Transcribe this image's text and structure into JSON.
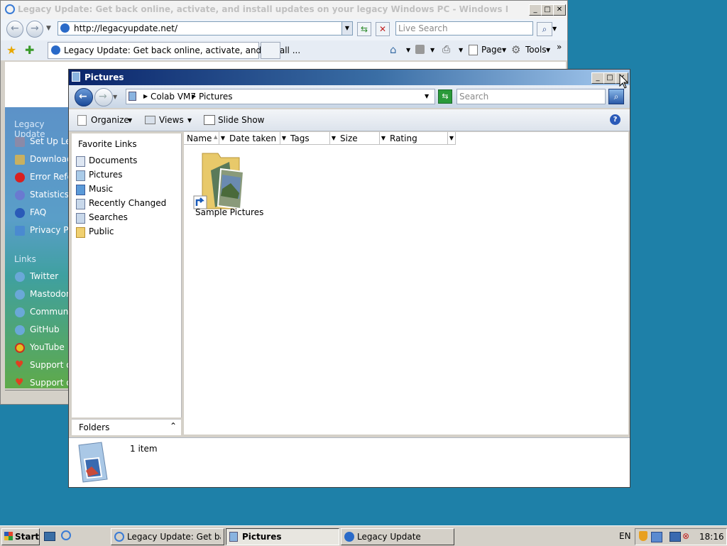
{
  "ie": {
    "title": "Legacy Update: Get back online, activate, and install updates on your legacy Windows PC - Windows Internet Explorer",
    "address": "http://legacyupdate.net/",
    "search_placeholder": "Live Search",
    "tab_label": "Legacy Update: Get back online, activate, and install ...",
    "cmd_page": "Page",
    "cmd_tools": "Tools",
    "sidebar": {
      "heading": "Legacy Update",
      "items": [
        {
          "label": "Set Up Le",
          "icon": "setup-icon"
        },
        {
          "label": "Download",
          "icon": "download-icon"
        },
        {
          "label": "Error Refe",
          "icon": "error-icon"
        },
        {
          "label": "Statistics",
          "icon": "statistics-icon"
        },
        {
          "label": "FAQ",
          "icon": "help-icon"
        },
        {
          "label": "Privacy Po",
          "icon": "privacy-icon"
        }
      ],
      "links_heading": "Links",
      "links": [
        {
          "label": "Twitter",
          "icon": "twitter-icon"
        },
        {
          "label": "Mastodon",
          "icon": "mastodon-icon"
        },
        {
          "label": "Communit",
          "icon": "community-icon"
        },
        {
          "label": "GitHub",
          "icon": "github-icon"
        },
        {
          "label": "YouTube",
          "icon": "youtube-icon"
        },
        {
          "label": "Support o",
          "icon": "heart-icon"
        },
        {
          "label": "Support o",
          "icon": "heart-icon"
        }
      ]
    }
  },
  "explorer": {
    "title": "Pictures",
    "breadcrumb": [
      "Colab VM7",
      "Pictures"
    ],
    "search_placeholder": "Search",
    "toolbar": {
      "organize": "Organize",
      "views": "Views",
      "slideshow": "Slide Show"
    },
    "favorite_links_heading": "Favorite Links",
    "favorite_links": [
      "Documents",
      "Pictures",
      "Music",
      "Recently Changed",
      "Searches",
      "Public"
    ],
    "folders_label": "Folders",
    "columns": [
      "Name",
      "Date taken",
      "Tags",
      "Size",
      "Rating"
    ],
    "items": [
      {
        "label": "Sample Pictures"
      }
    ],
    "details": "1 item"
  },
  "taskbar": {
    "start": "Start",
    "tasks": [
      {
        "label": "Legacy Update: Get bac...",
        "active": false
      },
      {
        "label": "Pictures",
        "active": true
      },
      {
        "label": "Legacy Update",
        "active": false
      }
    ],
    "language": "EN",
    "clock": "18:16"
  }
}
